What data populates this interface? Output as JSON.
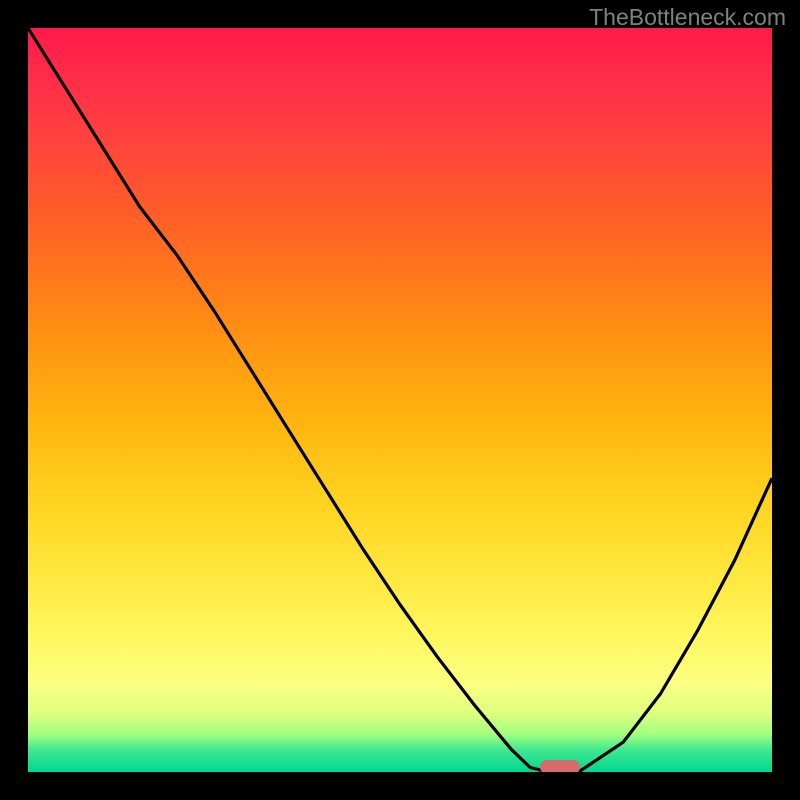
{
  "watermark": "TheBottleneck.com",
  "chart_data": {
    "type": "line",
    "title": "",
    "xlabel": "",
    "ylabel": "",
    "x": [
      0.0,
      0.05,
      0.1,
      0.15,
      0.2,
      0.25,
      0.3,
      0.35,
      0.4,
      0.45,
      0.5,
      0.55,
      0.6,
      0.65,
      0.675,
      0.7,
      0.74,
      0.8,
      0.85,
      0.9,
      0.95,
      1.0
    ],
    "y": [
      1.0,
      0.92,
      0.84,
      0.76,
      0.695,
      0.62,
      0.54,
      0.46,
      0.38,
      0.3,
      0.225,
      0.155,
      0.09,
      0.03,
      0.006,
      0.0,
      0.0,
      0.04,
      0.105,
      0.19,
      0.285,
      0.395
    ],
    "xlim": [
      0,
      1
    ],
    "ylim": [
      0,
      1
    ],
    "minimum_marker": {
      "x": 0.715,
      "y": 0.0
    },
    "background_gradient": "red-yellow-green-vertical",
    "colors": {
      "curve": "#000000",
      "marker": "#d86a6a"
    }
  }
}
